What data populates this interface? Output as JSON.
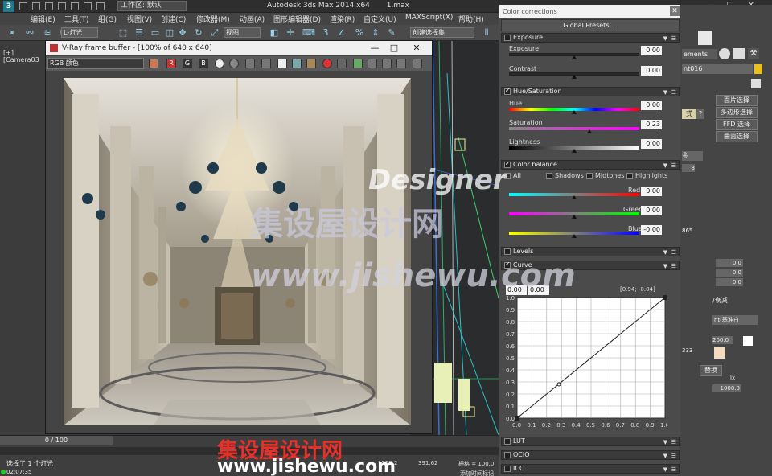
{
  "titlebar": {
    "workspace": "工作区: 默认",
    "app_title": "Autodesk 3ds Max  2014 x64",
    "file_name": "1.max"
  },
  "menu": {
    "items": [
      "编辑(E)",
      "工具(T)",
      "组(G)",
      "视图(V)",
      "创建(C)",
      "修改器(M)",
      "动画(A)",
      "图形编辑器(D)",
      "渲染(R)",
      "自定义(U)",
      "MAXScript(X)",
      "帮助(H)"
    ]
  },
  "toolbar": {
    "light_dropdown": "L-灯光",
    "view_dropdown": "视图",
    "selset_dropdown": "创建选择集"
  },
  "viewport": {
    "label": "[+] [Camera03"
  },
  "vfb": {
    "title": "V-Ray frame buffer - [100% of 640 x 640]",
    "channel": "RGB 颜色",
    "btn_r": "R",
    "btn_g": "G",
    "btn_b": "B"
  },
  "cc": {
    "title": "Color corrections",
    "presets": "Global Presets ...",
    "exposure": {
      "header": "Exposure",
      "exposure_label": "Exposure",
      "exposure_value": "0.00",
      "contrast_label": "Contrast",
      "contrast_value": "0.00"
    },
    "hue_sat": {
      "header": "Hue/Saturation",
      "hue_label": "Hue",
      "hue_value": "0.00",
      "sat_label": "Saturation",
      "sat_value": "0.23",
      "light_label": "Lightness",
      "light_value": "0.00"
    },
    "color_balance": {
      "header": "Color balance",
      "all": "All",
      "shadows": "Shadows",
      "midtones": "Midtones",
      "highlights": "Highlights",
      "red_label": "Red",
      "red_value": "0.00",
      "green_label": "Green",
      "green_value": "0.00",
      "blue_label": "Blue",
      "blue_value": "-0.00"
    },
    "levels": {
      "header": "Levels"
    },
    "curve": {
      "header": "Curve",
      "in_x": "0.00",
      "in_y": "0.00",
      "coord": "[0.94; -0.04]",
      "y_ticks": [
        "1.0",
        "0.9",
        "0.8",
        "0.7",
        "0.6",
        "0.5",
        "0.4",
        "0.3",
        "0.2",
        "0.1",
        "0.0"
      ],
      "x_ticks": [
        "0.0",
        "0.1",
        "0.2",
        "0.3",
        "0.4",
        "0.5",
        "0.6",
        "0.7",
        "0.8",
        "0.9",
        "1.0"
      ]
    },
    "lut": {
      "header": "LUT"
    },
    "ocio": {
      "header": "OCIO"
    },
    "icc": {
      "header": "ICC"
    }
  },
  "cmd": {
    "tab": "ements",
    "object_name": "nt016",
    "buttons": [
      "面片选择",
      "多边形选择",
      "FFD 选择",
      "曲面选择"
    ],
    "suffix_label": "式",
    "mode_label": "/衰减",
    "mode_dropdown": "nt(基准白",
    "lx_label": "lx",
    "bottom_btn": "替换",
    "num_1": "0.0",
    "num_2": "0.0",
    "num_3": "0.0",
    "value_1000": "1000.0",
    "value_200": "200.0",
    "value_865": "865",
    "value_333": "333",
    "value_8": "8",
    "dropdown_q": "金"
  },
  "status": {
    "timeslider": "0 / 100",
    "message": "选择了 1 个灯光",
    "time": "02:07:35",
    "coord_x": "1559.2",
    "coord_y": "391.62",
    "grid": "栅格 = 100.0",
    "bottom_hint": "添加时间标记"
  },
  "watermarks": {
    "designer": "Designer",
    "brand": "集设屋设计网",
    "url": "www.jishewu.com"
  },
  "colors": {
    "accent": "#1f7a8c",
    "wm_red": "#e8302a",
    "panel_bg": "#4b4b4b"
  }
}
